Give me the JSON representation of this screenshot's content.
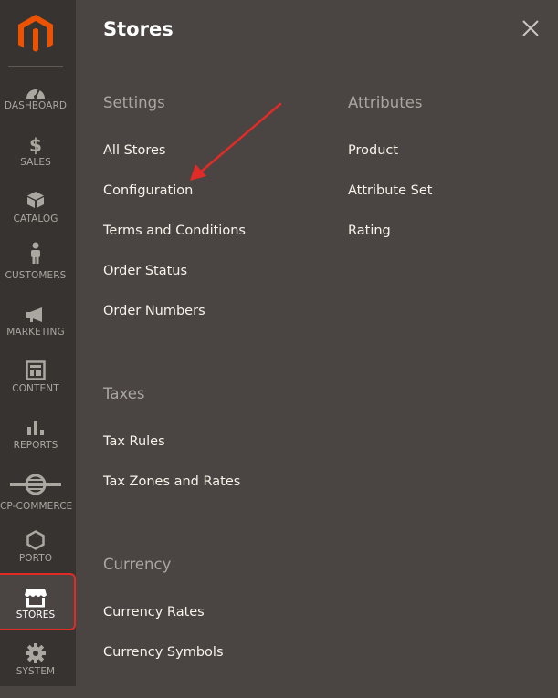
{
  "sidebar": {
    "items": [
      {
        "label": "DASHBOARD",
        "icon": "dashboard-icon"
      },
      {
        "label": "SALES",
        "icon": "dollar-icon"
      },
      {
        "label": "CATALOG",
        "icon": "cube-icon"
      },
      {
        "label": "CUSTOMERS",
        "icon": "person-icon"
      },
      {
        "label": "MARKETING",
        "icon": "megaphone-icon"
      },
      {
        "label": "CONTENT",
        "icon": "layout-icon"
      },
      {
        "label": "REPORTS",
        "icon": "bar-chart-icon"
      },
      {
        "label": "CP-COMMERCE",
        "icon": "globe-icon"
      },
      {
        "label": "PORTO",
        "icon": "hexagon-icon"
      },
      {
        "label": "STORES",
        "icon": "store-icon"
      },
      {
        "label": "SYSTEM",
        "icon": "gear-icon"
      }
    ],
    "active": "STORES"
  },
  "panel": {
    "title": "Stores",
    "sections": {
      "settings": {
        "title": "Settings",
        "links": [
          "All Stores",
          "Configuration",
          "Terms and Conditions",
          "Order Status",
          "Order Numbers"
        ]
      },
      "attributes": {
        "title": "Attributes",
        "links": [
          "Product",
          "Attribute Set",
          "Rating"
        ]
      },
      "taxes": {
        "title": "Taxes",
        "links": [
          "Tax Rules",
          "Tax Zones and Rates"
        ]
      },
      "currency": {
        "title": "Currency",
        "links": [
          "Currency Rates",
          "Currency Symbols"
        ]
      }
    }
  },
  "colors": {
    "sidebar_bg": "#373330",
    "panel_bg": "#4a4542",
    "logo_orange": "#eb5202",
    "annotation_red": "#e02b27"
  }
}
